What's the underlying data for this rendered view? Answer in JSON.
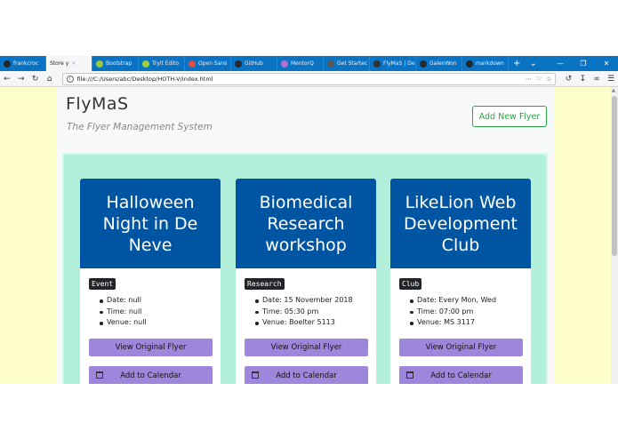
{
  "browser": {
    "tabs": [
      {
        "label": "frankcroc",
        "color": "#24292e",
        "active": false
      },
      {
        "label": "Store y",
        "color": "#ffffff",
        "active": true
      },
      {
        "label": "Bootstrap",
        "color": "#9ccc39",
        "active": false
      },
      {
        "label": "Tryit Edito",
        "color": "#9ccc39",
        "active": false
      },
      {
        "label": "Open Sans",
        "color": "#e34c4c",
        "active": false
      },
      {
        "label": "GitHub",
        "color": "#24292e",
        "active": false
      },
      {
        "label": "MentorQ",
        "color": "#b070d0",
        "active": false
      },
      {
        "label": "Get Startec",
        "color": "#5a5a5a",
        "active": false
      },
      {
        "label": "FlyMaS | De",
        "color": "#333333",
        "active": false
      },
      {
        "label": "GalenWon",
        "color": "#24292e",
        "active": false
      },
      {
        "label": "markdown",
        "color": "#24292e",
        "active": false
      }
    ],
    "new_tab": "+",
    "tab_list": "⌄",
    "window_controls": [
      "—",
      "❐",
      "✕"
    ],
    "url": "file:///C:/Users/abc/Desktop/HOTH-V/index.html",
    "nav_icons": [
      "back-icon",
      "forward-icon",
      "reload-icon",
      "home-icon"
    ]
  },
  "app": {
    "title": "FlyMaS",
    "subtitle": "The Flyer Management System",
    "add_button": "Add New Flyer"
  },
  "flyers": [
    {
      "title": "Halloween Night in De Neve",
      "tag": "Event",
      "date": "Date: null",
      "time": "Time: null",
      "venue": "Venue: null",
      "view_label": "View Original Flyer",
      "calendar_label": "Add to Calendar"
    },
    {
      "title": "Biomedical Research workshop",
      "tag": "Research",
      "date": "Date: 15 November 2018",
      "time": "Time: 05:30 pm",
      "venue": "Venue: Boelter 5113",
      "view_label": "View Original Flyer",
      "calendar_label": "Add to Calendar"
    },
    {
      "title": "LikeLion Web Development Club",
      "tag": "Club",
      "date": "Date: Every Mon, Wed",
      "time": "Time: 07:00 pm",
      "venue": "Venue: MS 3117",
      "view_label": "View Original Flyer",
      "calendar_label": "Add to Calendar"
    }
  ],
  "colors": {
    "page_bg": "#ffffcc",
    "board_bg": "#b2f0dc",
    "card_header": "#0055a3",
    "button": "#9f86dd",
    "accent_green": "#28a745",
    "tabbar": "#0b73c3"
  }
}
